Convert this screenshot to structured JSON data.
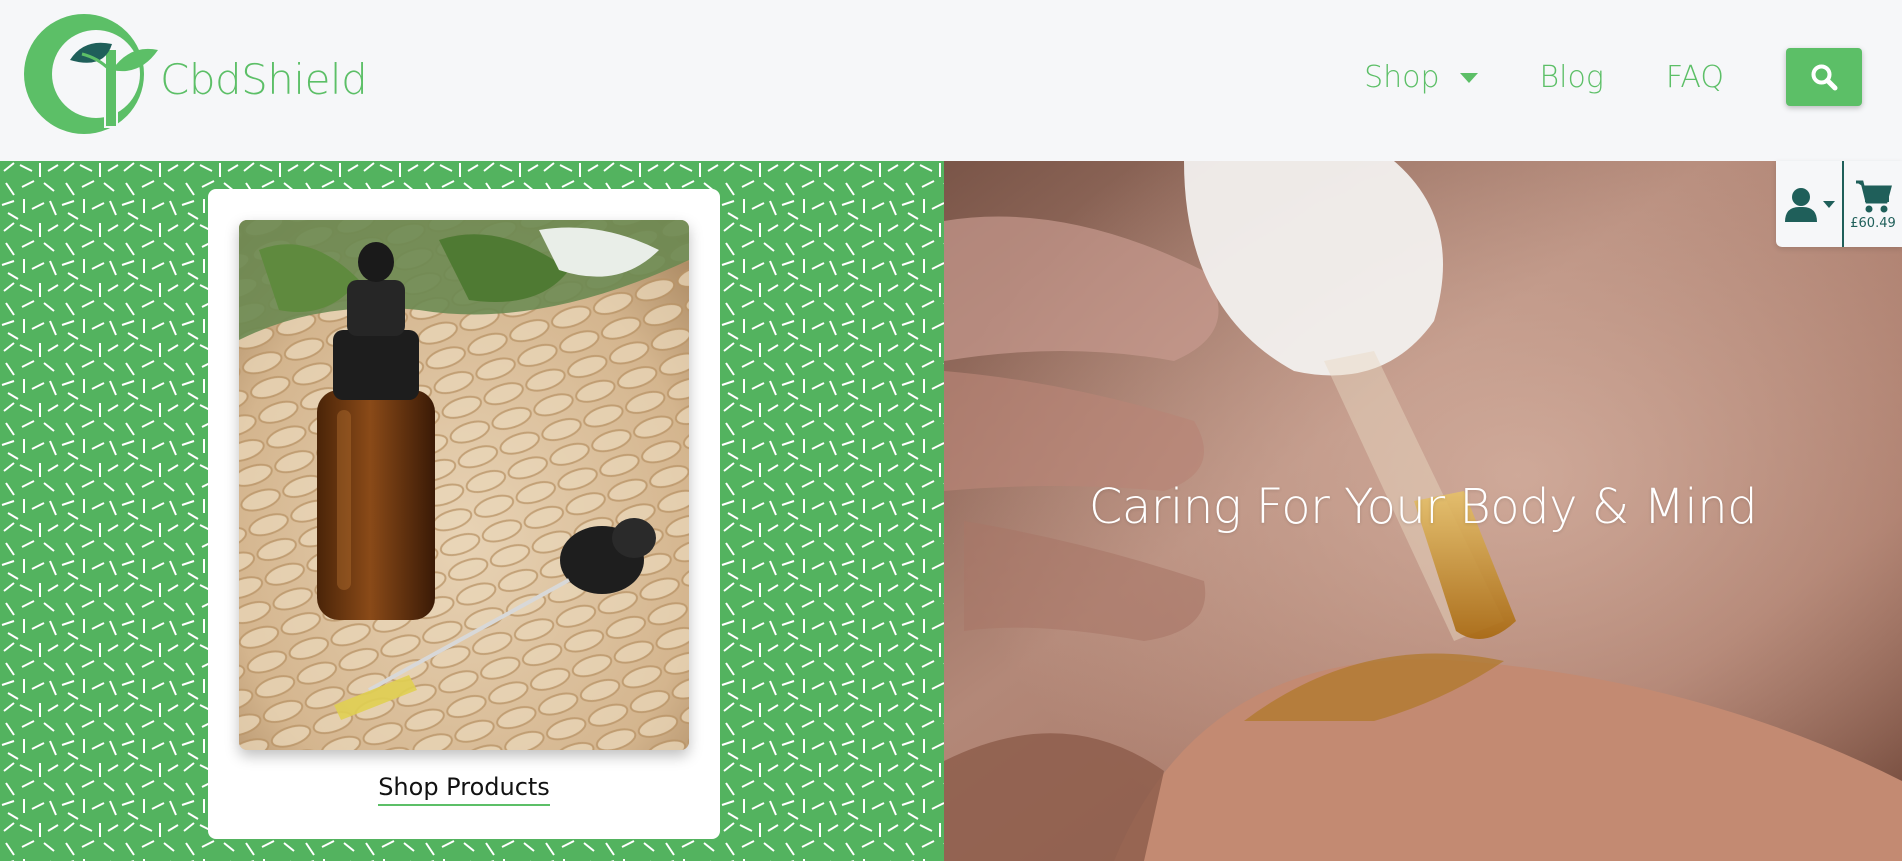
{
  "brand": {
    "name": "CbdShield"
  },
  "nav": {
    "items": [
      {
        "label": "Shop",
        "has_dropdown": true
      },
      {
        "label": "Blog",
        "has_dropdown": false
      },
      {
        "label": "FAQ",
        "has_dropdown": false
      }
    ],
    "search_icon": "search-icon"
  },
  "account": {
    "icon": "user-icon",
    "dropdown_icon": "caret-down-icon"
  },
  "cart": {
    "icon": "cart-icon",
    "total": "£60.49"
  },
  "promo_card": {
    "link_label": "Shop Products",
    "image": "cbd-oil-bottle-photo"
  },
  "hero": {
    "title": "Caring For Your Body & Mind",
    "image": "cbd-oil-dropper-on-hand-photo"
  },
  "colors": {
    "brand_green": "#5cbf67",
    "panel_green": "#53b35f",
    "dark_teal": "#1f5f5a",
    "header_bg": "#f6f7f9"
  }
}
